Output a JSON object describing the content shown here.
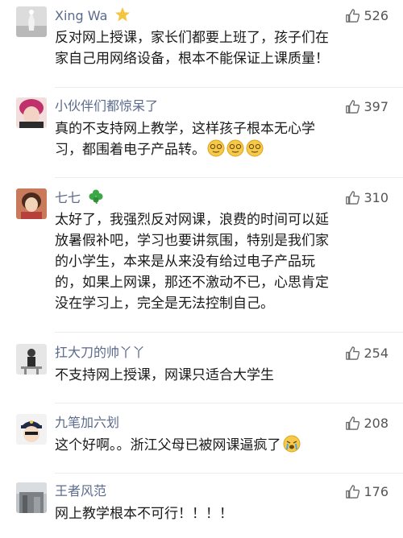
{
  "comments": [
    {
      "username": "Xing Wa",
      "likes": "526",
      "content": "反对网上授课，家长们都要上班了，孩子们在\n家自己用网络设备，根本不能保证上课质量！"
    },
    {
      "username": "小伙伴们都惊呆了",
      "likes": "397",
      "content": "真的不支持网上教学，这样孩子根本无心学\n习，都围着电子产品转。"
    },
    {
      "username": "七七",
      "likes": "310",
      "content": "太好了，我强烈反对网课，浪费的时间可以延\n放暑假补吧，学习也要讲氛围，特别是我们家\n的小学生，本来是从来没有给过电子产品玩\n的，如果上网课，那还不激动不已，心思肯定\n没在学习上，完全是无法控制自己。"
    },
    {
      "username": "扛大刀的帅丫丫",
      "likes": "254",
      "content": "不支持网上授课，网课只适合大学生"
    },
    {
      "username": "九笔加六划",
      "likes": "208",
      "content": "这个好啊。。浙江父母已被网课逼疯了"
    },
    {
      "username": "王者风范",
      "likes": "176",
      "content": "网上教学根本不可行！！！！"
    }
  ],
  "colors": {
    "username": "#5b6b8c",
    "content": "#1a1a1a",
    "like": "#555555",
    "divider": "#ececec"
  },
  "icons": {
    "like": "thumbs-up-icon",
    "badge_1": "star-badge-icon",
    "badge_3": "clover-icon",
    "emoji_2": "dizzy-face-emoji",
    "emoji_5": "crying-face-emoji"
  }
}
